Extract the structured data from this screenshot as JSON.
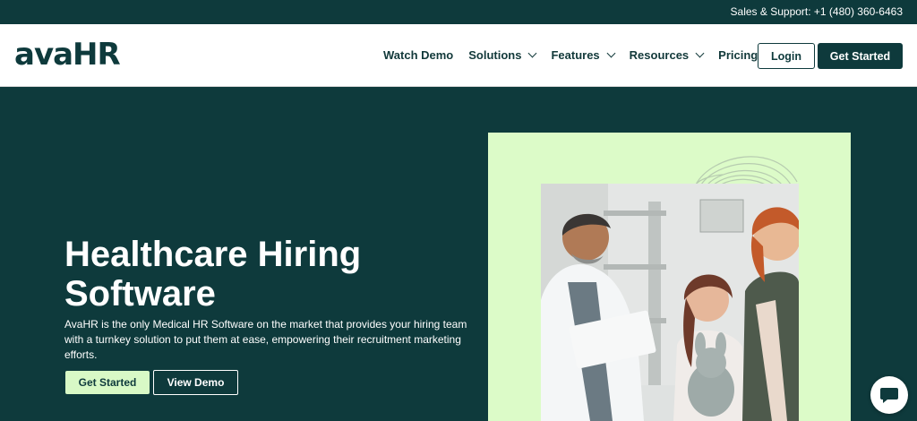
{
  "topbar": {
    "support_text": "Sales & Support: +1 (480) 360-6463"
  },
  "header": {
    "logo_text": "avaHR",
    "nav": [
      {
        "label": "Watch Demo",
        "has_dropdown": false
      },
      {
        "label": "Solutions",
        "has_dropdown": true
      },
      {
        "label": "Features",
        "has_dropdown": true
      },
      {
        "label": "Resources",
        "has_dropdown": true
      },
      {
        "label": "Pricing",
        "has_dropdown": false
      }
    ],
    "login_label": "Login",
    "get_started_label": "Get Started"
  },
  "hero": {
    "title": "Healthcare Hiring Software",
    "description": "AvaHR is the only Medical HR Software on the market that provides your hiring team with a turnkey solution to put them at ease, empowering their recruitment marketing efforts.",
    "primary_button": "Get Started",
    "secondary_button": "View Demo"
  },
  "colors": {
    "brand_dark": "#0e3a3c",
    "accent_mint": "#d8f9c6",
    "panel_bg": "#dcfbc8"
  },
  "icons": {
    "chat": "chat-bubble-icon",
    "dropdown": "chevron-down-icon"
  }
}
